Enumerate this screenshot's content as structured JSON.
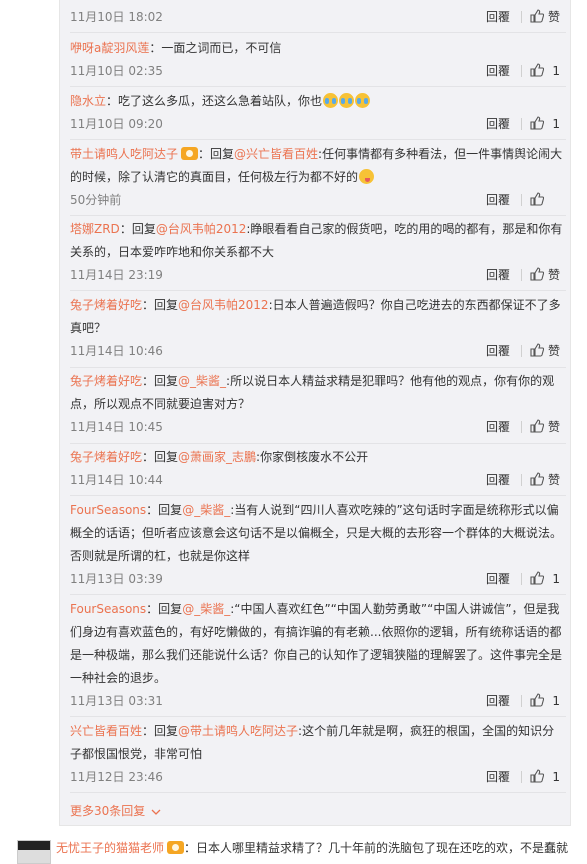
{
  "actions": {
    "reply": "回覆",
    "like_icon": "thumbs-up-icon"
  },
  "comments": [
    {
      "user": "",
      "segments": [],
      "time": "11月10日 18:02",
      "likes": "赞"
    },
    {
      "user": "咿呀a靛羽风莲",
      "segments": [
        {
          "t": "：一面之词而已，不可信"
        }
      ],
      "time": "11月10日 02:35",
      "likes": "1"
    },
    {
      "user": "隐水立",
      "segments": [
        {
          "t": "：吃了这么多瓜，还这么急着站队，你也"
        }
      ],
      "time": "11月10日 09:20",
      "likes": "1"
    },
    {
      "user": "带土请鸣人吃阿达子",
      "prefix": "：回复",
      "mention": "@兴亡皆看百姓",
      "segments": [
        {
          "t": ":任何事情都有多种看法，但一件事情舆论闹大的时候，除了认清它的真面目，任何极左行为都不好的"
        }
      ],
      "time": "50分钟前",
      "likes": ""
    },
    {
      "user": "塔娜ZRD",
      "prefix": "：回复",
      "mention": "@台风韦帕2012",
      "segments": [
        {
          "t": ":睁眼看看自己家的假货吧，吃的用的喝的都有，那是和你有关系的，日本爱咋咋地和你关系都不大"
        }
      ],
      "time": "11月14日 23:19",
      "likes": "赞"
    },
    {
      "user": "兔子烤着好吃",
      "prefix": "：回复",
      "mention": "@台风韦帕2012",
      "segments": [
        {
          "t": ":日本人普遍造假吗？你自己吃进去的东西都保证不了多真吧？"
        }
      ],
      "time": "11月14日 10:46",
      "likes": "赞"
    },
    {
      "user": "兔子烤着好吃",
      "prefix": "：回复",
      "mention": "@_柴酱_",
      "segments": [
        {
          "t": ":所以说日本人精益求精是犯罪吗？他有他的观点，你有你的观点，所以观点不同就要迫害对方？"
        }
      ],
      "time": "11月14日 10:45",
      "likes": "赞"
    },
    {
      "user": "兔子烤着好吃",
      "prefix": "：回复",
      "mention": "@萧画家_志鵬",
      "segments": [
        {
          "t": ":你家倒核废水不公开"
        }
      ],
      "time": "11月14日 10:44",
      "likes": "赞"
    },
    {
      "user": "FourSeasons",
      "prefix": "：回复",
      "mention": "@_柴酱_",
      "segments": [
        {
          "t": ":当有人说到“四川人喜欢吃辣的”这句话时字面是统称形式以偏概全的话语；但听者应该意会这句话不是以偏概全，只是大概的去形容一个群体的大概说法。否则就是所谓的杠，也就是你这样"
        }
      ],
      "time": "11月13日 03:39",
      "likes": "1"
    },
    {
      "user": "FourSeasons",
      "prefix": "：回复",
      "mention": "@_柴酱_",
      "segments": [
        {
          "t": ":“中国人喜欢红色”“中国人勤劳勇敢”“中国人讲诚信”，但是我们身边有喜欢蓝色的，有好吃懒做的，有搞诈骗的有老赖...依照你的逻辑，所有统称话语的都是一种极端，那么我们还能说什么话？你自己的认知作了逻辑狭隘的理解罢了。这件事完全是一种社会的退步。"
        }
      ],
      "time": "11月13日 03:31",
      "likes": "1"
    },
    {
      "user": "兴亡皆看百姓",
      "prefix": "：回复",
      "mention": "@带土请鸣人吃阿达子",
      "segments": [
        {
          "t": ":这个前几年就是啊，疯狂的根国，全国的知识分子都恨国恨党，非常可怕"
        }
      ],
      "time": "11月12日 23:46",
      "likes": "1"
    }
  ],
  "more_link": "更多30条回复",
  "bottom": {
    "user": "无忧王子的猫猫老师",
    "text": "：日本人哪里精益求精了？几十年前的洗脑包了现在还吃的欢，不是蠢就"
  },
  "colors": {
    "link": "#eb7350",
    "panel": "#f2f2f5"
  }
}
